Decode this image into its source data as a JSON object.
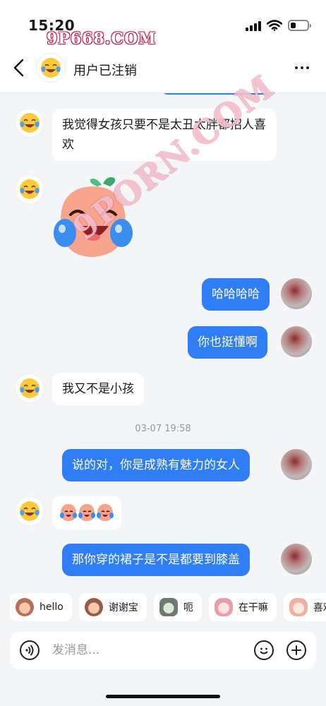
{
  "status_bar": {
    "time": "15:20",
    "battery_level": 0.3
  },
  "watermark": {
    "top_text": "9P668.COM",
    "diagonal_text": "9PORN.COM"
  },
  "header": {
    "title": "用户已注销",
    "back_icon": "chevron-left-icon",
    "more_icon": "more-dots-icon"
  },
  "messages": [
    {
      "side": "left",
      "type": "text",
      "text": "我觉得女孩只要不是太丑太胖都招人喜欢"
    },
    {
      "side": "left",
      "type": "sticker",
      "sticker": "crying-laughing-peach-sticker"
    },
    {
      "side": "right",
      "type": "text",
      "text": "哈哈哈哈"
    },
    {
      "side": "right",
      "type": "text",
      "text": "你也挺懂啊"
    },
    {
      "side": "left",
      "type": "text",
      "text": "我又不是小孩"
    },
    {
      "side": "right",
      "type": "text",
      "text": "说的对，你是成熟有魅力的女人"
    },
    {
      "side": "left",
      "type": "emoji",
      "emoji": "crying-laughing-peach-emoji x3"
    },
    {
      "side": "right",
      "type": "text",
      "text": "那你穿的裙子是不是都要到膝盖"
    }
  ],
  "timestamp": "03-07 19:58",
  "quick_replies": [
    {
      "label": "hello",
      "icon": "monkey-icon",
      "color": "#b4705a"
    },
    {
      "label": "谢谢宝",
      "icon": "monkey-bow-icon",
      "color": "#9a5a4a"
    },
    {
      "label": "呃",
      "icon": "cat-icon",
      "color": "#6b7b6b"
    },
    {
      "label": "在干嘛",
      "icon": "peach-face-icon",
      "color": "#e8a0a8"
    },
    {
      "label": "喜欢",
      "icon": "peach-heart-icon",
      "color": "#f0b0a0"
    }
  ],
  "input": {
    "placeholder": "发消息..."
  },
  "colors": {
    "accent": "#2f7ef5",
    "background": "#f4f5f7",
    "bubble_left": "#ffffff"
  }
}
